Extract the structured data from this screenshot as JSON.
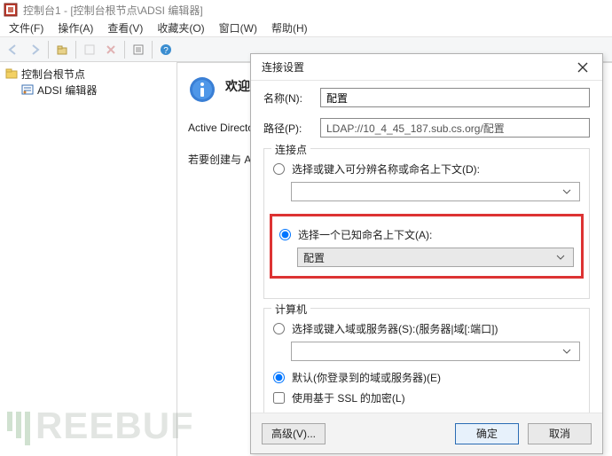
{
  "window": {
    "title": "控制台1 - [控制台根节点\\ADSI 编辑器]"
  },
  "menu": {
    "file": "文件(F)",
    "action": "操作(A)",
    "view": "查看(V)",
    "favorites": "收藏夹(O)",
    "window": "窗口(W)",
    "help": "帮助(H)"
  },
  "tree": {
    "root": "控制台根节点",
    "child": "ADSI 编辑器"
  },
  "content": {
    "welcome": "欢迎使",
    "para1": "Active Directory                                                                                                          ory 轻型目\n服务的低级别的",
    "para2": "若要创建与 AD D"
  },
  "dialog": {
    "title": "连接设置",
    "name_label": "名称(N):",
    "name_value": "配置",
    "path_label": "路径(P):",
    "path_value": "LDAP://10_4_45_187.sub.cs.org/配置",
    "cp": {
      "legend": "连接点",
      "opt_dn": "选择或键入可分辨名称或命名上下文(D):",
      "opt_known": "选择一个已知命名上下文(A):",
      "known_value": "配置"
    },
    "comp": {
      "legend": "计算机",
      "opt_domain": "选择或键入域或服务器(S):(服务器|域[:端口])",
      "opt_default": "默认(你登录到的域或服务器)(E)",
      "ssl": "使用基于 SSL 的加密(L)"
    },
    "buttons": {
      "advanced": "高级(V)...",
      "ok": "确定",
      "cancel": "取消"
    }
  },
  "watermark": {
    "text": "REEBUF"
  }
}
